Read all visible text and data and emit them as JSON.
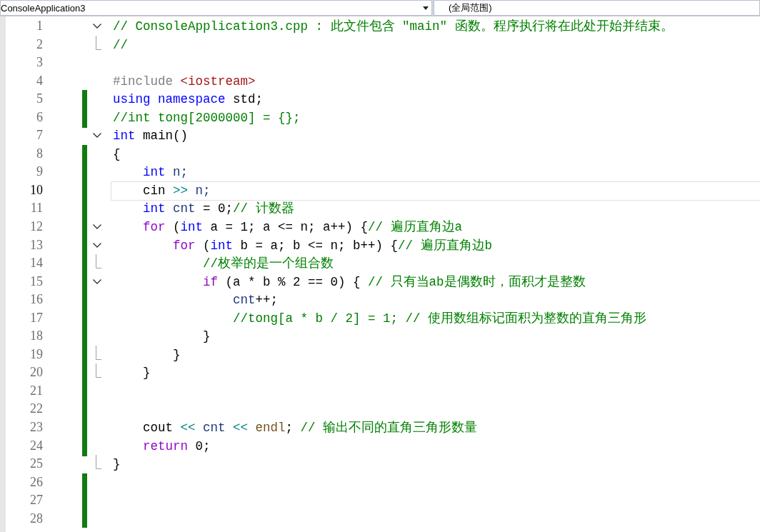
{
  "navigation_bar": {
    "project_dropdown": "ConsoleApplication3",
    "scope_dropdown": "(全局范围)"
  },
  "lines": [
    {
      "number": "1",
      "changed": false,
      "current": false,
      "fold_start": true,
      "fold_end": false,
      "tokens": [
        {
          "kind": "comment",
          "text": "// ConsoleApplication3.cpp : 此文件包含 \"main\" 函数。程序执行将在此处开始并结束。"
        }
      ]
    },
    {
      "number": "2",
      "changed": false,
      "current": false,
      "fold_start": false,
      "fold_end": true,
      "tokens": [
        {
          "kind": "comment",
          "text": "//"
        }
      ]
    },
    {
      "number": "3",
      "changed": false,
      "current": false,
      "fold_start": false,
      "fold_end": false
    },
    {
      "number": "4",
      "changed": false,
      "current": false,
      "fold_start": false,
      "fold_end": false,
      "tokens": [
        {
          "kind": "preprocessor",
          "text": "#include"
        },
        {
          "kind": "string",
          "text": " <iostream>"
        }
      ]
    },
    {
      "number": "5",
      "changed": true,
      "current": false,
      "fold_start": false,
      "fold_end": false,
      "tokens": [
        {
          "kind": "keyword",
          "text": "using namespace"
        },
        {
          "kind": "plain",
          "text": " std;"
        }
      ]
    },
    {
      "number": "6",
      "changed": true,
      "current": false,
      "fold_start": false,
      "fold_end": false,
      "tokens": [
        {
          "kind": "comment",
          "text": "//int tong[2000000] = {};"
        }
      ]
    },
    {
      "number": "7",
      "changed": false,
      "current": false,
      "fold_start": true,
      "fold_end": false,
      "tokens": [
        {
          "kind": "keyword",
          "text": "int"
        },
        {
          "kind": "plain",
          "text": " main()"
        }
      ]
    },
    {
      "number": "8",
      "changed": true,
      "current": false,
      "fold_start": false,
      "fold_end": false,
      "tokens": [
        {
          "kind": "plain",
          "text": "{"
        }
      ]
    },
    {
      "number": "9",
      "changed": true,
      "current": false,
      "fold_start": false,
      "fold_end": false,
      "tokens": [
        {
          "kind": "keyword",
          "text": "    int"
        },
        {
          "kind": "variable",
          "text": " n;"
        }
      ]
    },
    {
      "number": "10",
      "changed": true,
      "current": true,
      "fold_start": false,
      "fold_end": false,
      "tokens": [
        {
          "kind": "plain",
          "text": "    cin "
        },
        {
          "kind": "operator",
          "text": ">>"
        },
        {
          "kind": "variable",
          "text": " n;"
        }
      ]
    },
    {
      "number": "11",
      "changed": true,
      "current": false,
      "fold_start": false,
      "fold_end": false,
      "tokens": [
        {
          "kind": "keyword",
          "text": "    int"
        },
        {
          "kind": "variable",
          "text": " cnt"
        },
        {
          "kind": "plain",
          "text": " = 0;"
        },
        {
          "kind": "comment",
          "text": "// 计数器"
        }
      ]
    },
    {
      "number": "12",
      "changed": true,
      "current": false,
      "fold_start": true,
      "fold_end": false,
      "tokens": [
        {
          "kind": "control",
          "text": "    for"
        },
        {
          "kind": "plain",
          "text": " ("
        },
        {
          "kind": "keyword",
          "text": "int"
        },
        {
          "kind": "plain",
          "text": " a = 1; a <= n; a++) {"
        },
        {
          "kind": "comment",
          "text": "// 遍历直角边a"
        }
      ]
    },
    {
      "number": "13",
      "changed": true,
      "current": false,
      "fold_start": true,
      "fold_end": false,
      "tokens": [
        {
          "kind": "control",
          "text": "        for"
        },
        {
          "kind": "plain",
          "text": " ("
        },
        {
          "kind": "keyword",
          "text": "int"
        },
        {
          "kind": "plain",
          "text": " b = a; b <= n; b++) {"
        },
        {
          "kind": "comment",
          "text": "// 遍历直角边b"
        }
      ]
    },
    {
      "number": "14",
      "changed": true,
      "current": false,
      "fold_start": false,
      "fold_end": true,
      "tokens": [
        {
          "kind": "comment",
          "text": "            //枚举的是一个组合数"
        }
      ]
    },
    {
      "number": "15",
      "changed": true,
      "current": false,
      "fold_start": true,
      "fold_end": false,
      "tokens": [
        {
          "kind": "control",
          "text": "            if"
        },
        {
          "kind": "plain",
          "text": " (a * b % 2 == 0) { "
        },
        {
          "kind": "comment",
          "text": "// 只有当ab是偶数时，面积才是整数"
        }
      ]
    },
    {
      "number": "16",
      "changed": true,
      "current": false,
      "fold_start": false,
      "fold_end": false,
      "tokens": [
        {
          "kind": "variable",
          "text": "                cnt"
        },
        {
          "kind": "plain",
          "text": "++;"
        }
      ]
    },
    {
      "number": "17",
      "changed": true,
      "current": false,
      "fold_start": false,
      "fold_end": false,
      "tokens": [
        {
          "kind": "comment",
          "text": "                //tong[a * b / 2] = 1; // 使用数组标记面积为整数的直角三角形"
        }
      ]
    },
    {
      "number": "18",
      "changed": true,
      "current": false,
      "fold_start": false,
      "fold_end": false,
      "tokens": [
        {
          "kind": "plain",
          "text": "            }"
        }
      ]
    },
    {
      "number": "19",
      "changed": true,
      "current": false,
      "fold_start": false,
      "fold_end": true,
      "tokens": [
        {
          "kind": "plain",
          "text": "        }"
        }
      ]
    },
    {
      "number": "20",
      "changed": true,
      "current": false,
      "fold_start": false,
      "fold_end": true,
      "tokens": [
        {
          "kind": "plain",
          "text": "    }"
        }
      ]
    },
    {
      "number": "21",
      "changed": true,
      "current": false,
      "fold_start": false,
      "fold_end": false
    },
    {
      "number": "22",
      "changed": true,
      "current": false,
      "fold_start": false,
      "fold_end": false
    },
    {
      "number": "23",
      "changed": true,
      "current": false,
      "fold_start": false,
      "fold_end": false,
      "tokens": [
        {
          "kind": "plain",
          "text": "    cout "
        },
        {
          "kind": "operator",
          "text": "<<"
        },
        {
          "kind": "variable",
          "text": " cnt "
        },
        {
          "kind": "operator",
          "text": "<<"
        },
        {
          "kind": "function",
          "text": " endl"
        },
        {
          "kind": "plain",
          "text": "; "
        },
        {
          "kind": "comment",
          "text": "// 输出不同的直角三角形数量"
        }
      ]
    },
    {
      "number": "24",
      "changed": true,
      "current": false,
      "fold_start": false,
      "fold_end": false,
      "tokens": [
        {
          "kind": "control",
          "text": "    return"
        },
        {
          "kind": "plain",
          "text": " 0;"
        }
      ]
    },
    {
      "number": "25",
      "changed": false,
      "current": false,
      "fold_start": false,
      "fold_end": true,
      "tokens": [
        {
          "kind": "plain",
          "text": "}"
        }
      ]
    },
    {
      "number": "26",
      "changed": true,
      "current": false,
      "fold_start": false,
      "fold_end": false
    },
    {
      "number": "27",
      "changed": true,
      "current": false,
      "fold_start": false,
      "fold_end": false
    },
    {
      "number": "28",
      "changed": true,
      "current": false,
      "fold_start": false,
      "fold_end": false
    }
  ]
}
